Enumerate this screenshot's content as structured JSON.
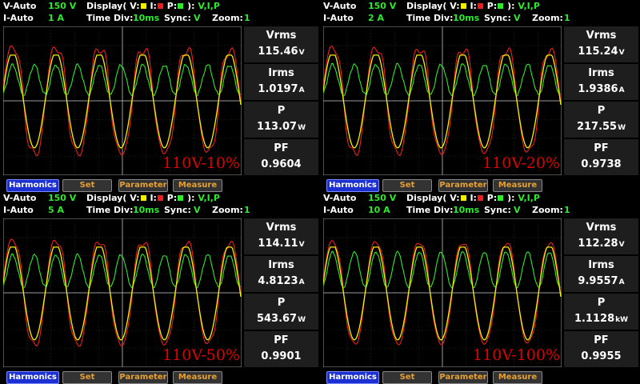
{
  "colors": {
    "voltage": "#f2f200",
    "current": "#ee1c1c",
    "power": "#2ee82e",
    "accent": "#1c2fd0"
  },
  "labels": {
    "v_auto": "V-Auto",
    "i_auto": "I-Auto",
    "display_prefix": "Display( V:",
    "display_i": " I:",
    "display_p": " P:",
    "display_suffix": " ):",
    "display_mode": "V,I,P",
    "time_div": "Time  Div:",
    "time_div_value": "10ms",
    "sync": "Sync:",
    "sync_value": "V",
    "zoom": "Zoom:",
    "zoom_value": "1",
    "vrms": "Vrms",
    "irms": "Irms",
    "p": "P",
    "pf": "PF"
  },
  "buttons": {
    "harmonics": "Harmonics",
    "set": "Set",
    "parameter": "Parameter",
    "measure": "Measure"
  },
  "panels": [
    {
      "v_range": "150  V",
      "i_range": "1  A",
      "vrms": "115.46",
      "vrms_unit": "V",
      "irms": "1.0197",
      "irms_unit": "A",
      "p": "113.07",
      "p_unit": "W",
      "pf": "0.9604",
      "tag": "110V-10%"
    },
    {
      "v_range": "150  V",
      "i_range": "2  A",
      "vrms": "115.24",
      "vrms_unit": "V",
      "irms": "1.9386",
      "irms_unit": "A",
      "p": "217.55",
      "p_unit": "W",
      "pf": "0.9738",
      "tag": "110V-20%"
    },
    {
      "v_range": "150  V",
      "i_range": "5  A",
      "vrms": "114.11",
      "vrms_unit": "V",
      "irms": "4.8123",
      "irms_unit": "A",
      "p": "543.67",
      "p_unit": "W",
      "pf": "0.9901",
      "tag": "110V-50%"
    },
    {
      "v_range": "150  V",
      "i_range": "10  A",
      "vrms": "112.28",
      "vrms_unit": "V",
      "irms": "9.9557",
      "irms_unit": "A",
      "p": "1.1128",
      "p_unit": "kW",
      "pf": "0.9955",
      "tag": "110V-100%"
    }
  ]
}
